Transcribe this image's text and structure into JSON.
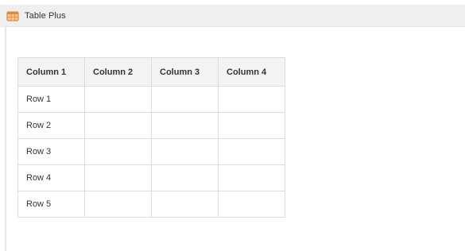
{
  "app": {
    "title": "Table Plus",
    "icon": "table-app-icon"
  },
  "table": {
    "columns": [
      "Column 1",
      "Column 2",
      "Column 3",
      "Column 4"
    ],
    "rows": [
      [
        "Row 1",
        "",
        "",
        ""
      ],
      [
        "Row 2",
        "",
        "",
        ""
      ],
      [
        "Row 3",
        "",
        "",
        ""
      ],
      [
        "Row 4",
        "",
        "",
        ""
      ],
      [
        "Row 5",
        "",
        "",
        ""
      ]
    ]
  },
  "colors": {
    "titlebar": "#efefef",
    "header_cell": "#f3f3f3",
    "border": "#dcdcdc",
    "icon_orange": "#e8893a"
  }
}
